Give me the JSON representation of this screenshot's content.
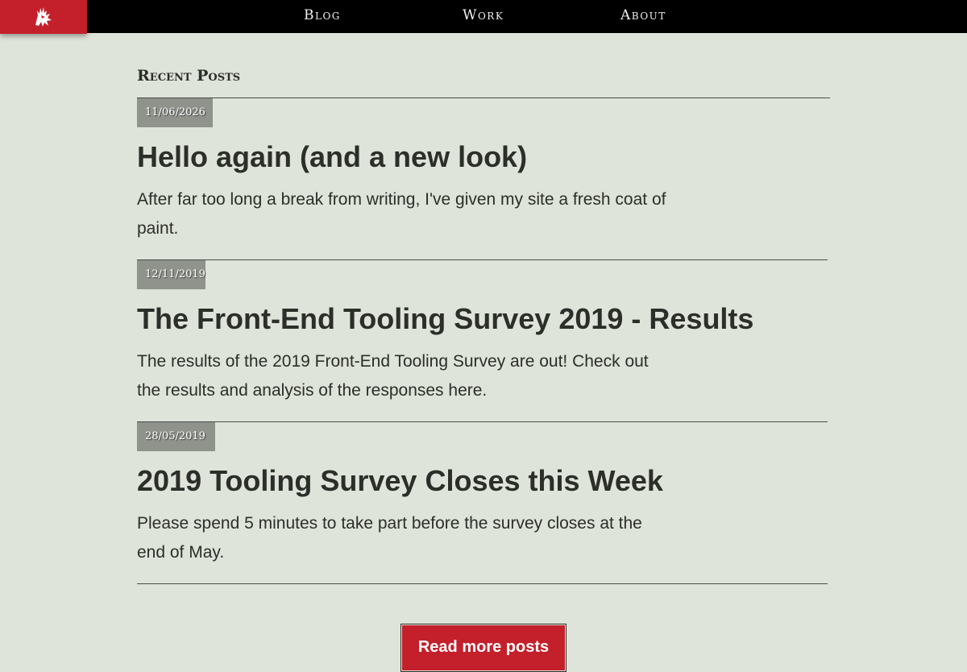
{
  "header": {
    "logo_icon": "dragon-logo-icon",
    "nav": [
      {
        "label": "Blog"
      },
      {
        "label": "Work"
      },
      {
        "label": "About"
      }
    ]
  },
  "main": {
    "section_title": "Recent Posts",
    "posts": [
      {
        "date": "11/06/2026",
        "title": "Hello again (and a new look)",
        "excerpt": "After far too long a break from writing, I've given my site a fresh coat of paint."
      },
      {
        "date": "12/11/2019",
        "title": "The Front-End Tooling Survey 2019 - Results",
        "excerpt": "The results of the 2019 Front-End Tooling Survey are out! Check out the results and analysis of the responses here."
      },
      {
        "date": "28/05/2019",
        "title": "2019 Tooling Survey Closes this Week",
        "excerpt": "Please spend 5 minutes to take part before the survey closes at the end of May."
      }
    ],
    "more_button_label": "Read more posts"
  },
  "colors": {
    "accent": "#c4202b",
    "background": "#dfe4da",
    "text": "#2c2e29",
    "date_badge": "#8f938c"
  }
}
